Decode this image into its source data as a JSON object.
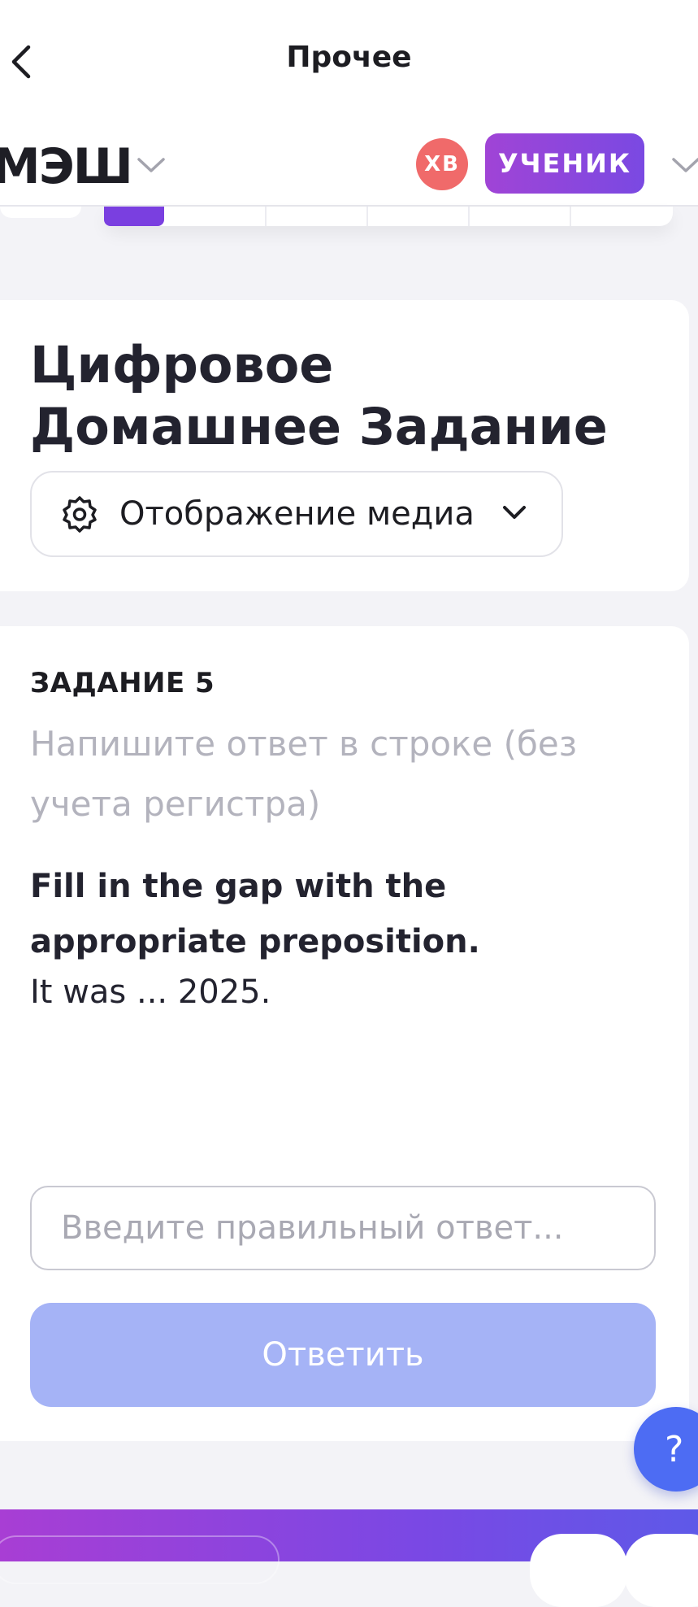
{
  "nav": {
    "title": "Прочее",
    "back_icon": "chevron-left-icon"
  },
  "header": {
    "logo": "МЭШ",
    "avatar_initials": "ХВ",
    "role": "УЧЕНИК",
    "colors": {
      "avatar": "#f06a6a",
      "role_from": "#a044d6",
      "role_to": "#7a49e2",
      "active_tab": "#7a3fe0"
    }
  },
  "homework": {
    "title": "Цифровое Домашнее Задание",
    "media_select": {
      "icon": "gear-icon",
      "label": "Отображение медиа"
    }
  },
  "task": {
    "label": "ЗАДАНИЕ 5",
    "hint": "Напишите ответ в строке (без учета регистра)",
    "question": "Fill in the gap with the appropriate preposition.",
    "sentence": "It was ... 2025.",
    "input_placeholder": "Введите правильный ответ...",
    "input_value": "",
    "submit_label": "Ответить",
    "submit_color": "#a5b3f6"
  },
  "help": {
    "label": "?",
    "color": "#4d6cf3"
  }
}
